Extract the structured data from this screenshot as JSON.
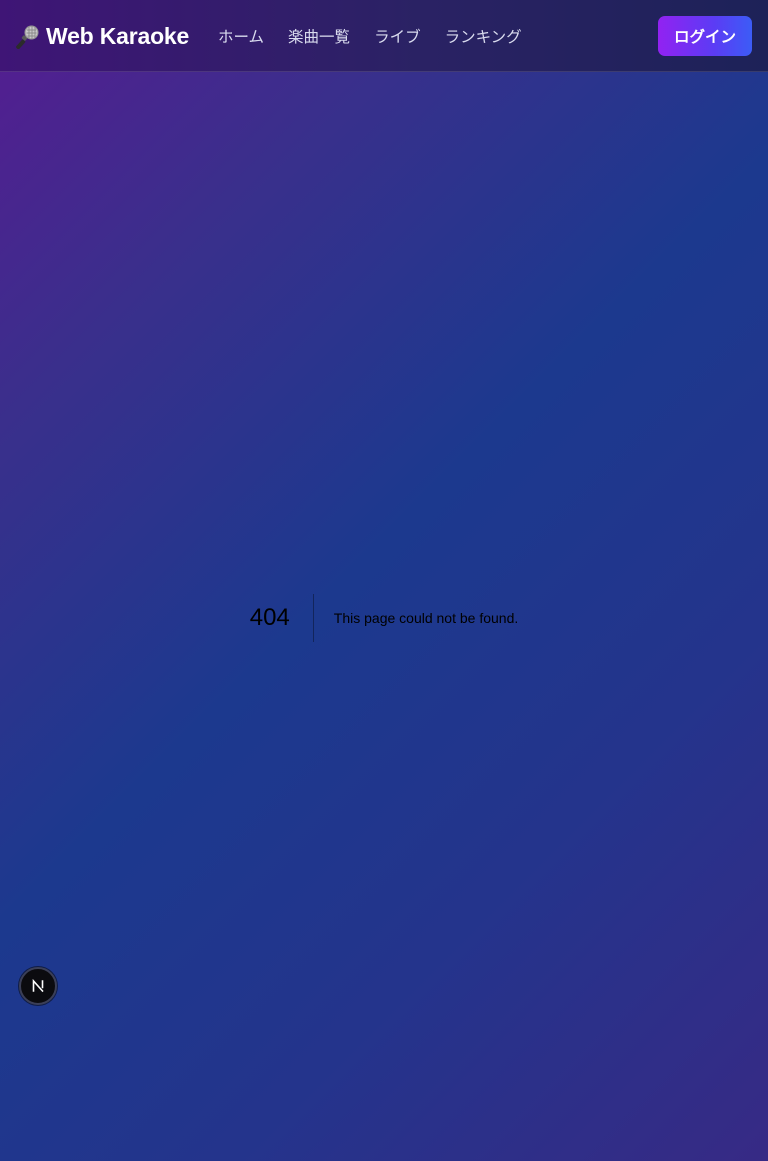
{
  "header": {
    "brand": {
      "icon": "microphone-icon",
      "name": "Web Karaoke"
    },
    "nav": [
      {
        "label": "ホーム"
      },
      {
        "label": "楽曲一覧"
      },
      {
        "label": "ライブ"
      },
      {
        "label": "ランキング"
      }
    ],
    "login_label": "ログイン"
  },
  "error": {
    "code": "404",
    "message": "This page could not be found."
  },
  "dev_badge": {
    "icon": "nextjs-logo-icon"
  },
  "colors": {
    "accent_gradient_start": "#9222f1",
    "accent_gradient_end": "#3c5cf6",
    "background_purple": "#561c91",
    "background_blue": "#1c398e"
  }
}
